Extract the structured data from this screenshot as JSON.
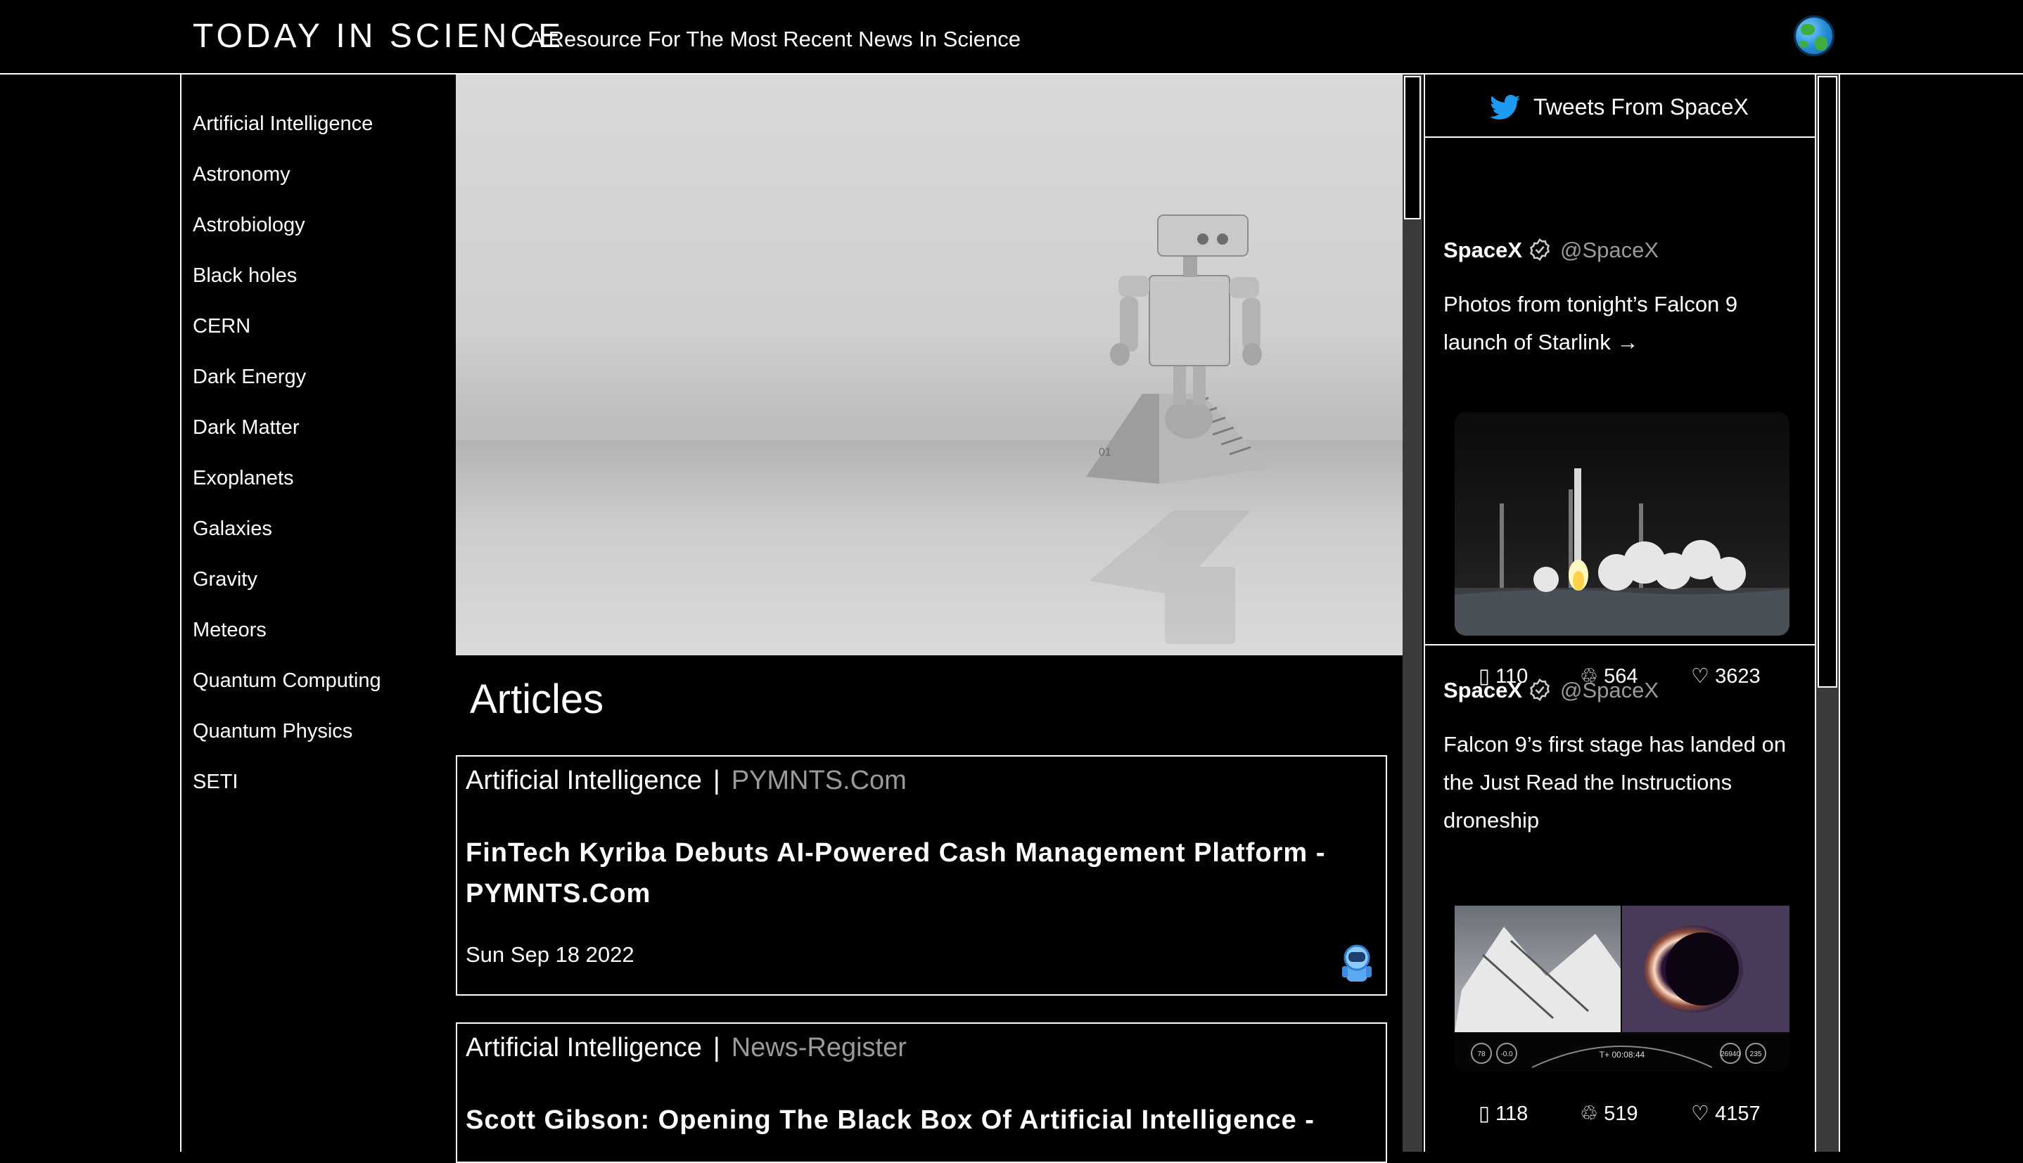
{
  "header": {
    "title": "TODAY IN SCIENCE",
    "tagline": "A Resource For The Most Recent News In Science"
  },
  "sidebar": {
    "items": [
      {
        "label": "Artificial Intelligence"
      },
      {
        "label": "Astronomy"
      },
      {
        "label": "Astrobiology"
      },
      {
        "label": "Black holes"
      },
      {
        "label": "CERN"
      },
      {
        "label": "Dark Energy"
      },
      {
        "label": "Dark Matter"
      },
      {
        "label": "Exoplanets"
      },
      {
        "label": "Galaxies"
      },
      {
        "label": "Gravity"
      },
      {
        "label": "Meteors"
      },
      {
        "label": "Quantum Computing"
      },
      {
        "label": "Quantum Physics"
      },
      {
        "label": "SETI"
      }
    ]
  },
  "main": {
    "articles_heading": "Articles",
    "hero_image_text": "01",
    "articles": [
      {
        "category": "Artificial Intelligence",
        "separator": "|",
        "source": "PYMNTS.Com",
        "title": "FinTech Kyriba Debuts AI-Powered Cash Management Platform - PYMNTS.Com",
        "date": "Sun Sep 18 2022"
      },
      {
        "category": "Artificial Intelligence",
        "separator": "|",
        "source": "News-Register",
        "title": "Scott Gibson: Opening The Black Box Of Artificial Intelligence -",
        "date": ""
      }
    ]
  },
  "twitter": {
    "header_title": "Tweets From SpaceX",
    "brand_color": "#1d9bf0",
    "tweets": [
      {
        "user": "SpaceX",
        "handle": "@SpaceX",
        "text": "Photos from tonight’s Falcon 9 launch of Starlink →",
        "replies": "110",
        "retweets": "564",
        "likes": "3623"
      },
      {
        "user": "SpaceX",
        "handle": "@SpaceX",
        "text": "Falcon 9’s first stage has landed on the Just Read the Instructions droneship",
        "replies": "118",
        "retweets": "519",
        "likes": "4157",
        "overlay": {
          "gauge_left_a": "78",
          "gauge_left_b": "-0.0",
          "timer": "T+ 00:08:44",
          "gauge_right_a": "26940",
          "gauge_right_b": "235"
        }
      }
    ],
    "icons": {
      "reply": "reply-icon",
      "retweet": "retweet-icon",
      "like": "heart-icon",
      "verified": "verified-badge-icon"
    }
  }
}
